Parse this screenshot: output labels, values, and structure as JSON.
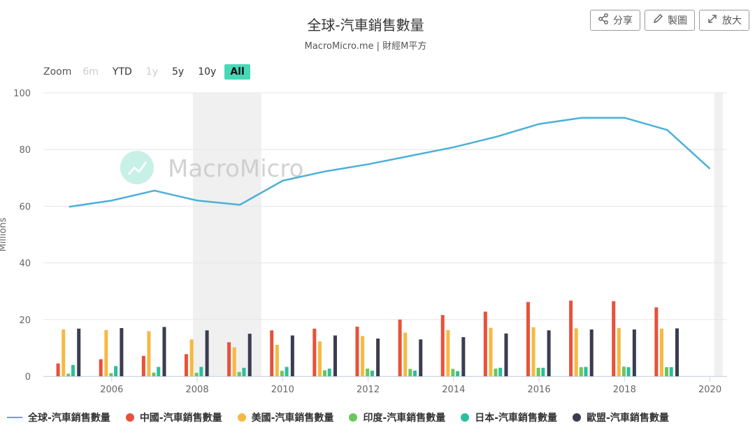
{
  "header": {
    "title": "全球-汽車銷售數量",
    "subtitle": "MacroMicro.me | 財經M平方",
    "buttons": [
      {
        "label": "分享",
        "icon": "share-icon"
      },
      {
        "label": "製圖",
        "icon": "pencil-icon"
      },
      {
        "label": "放大",
        "icon": "expand-icon"
      }
    ]
  },
  "zoom": {
    "label": "Zoom",
    "options": [
      {
        "label": "6m",
        "state": "disabled"
      },
      {
        "label": "YTD",
        "state": "normal"
      },
      {
        "label": "1y",
        "state": "disabled"
      },
      {
        "label": "5y",
        "state": "normal"
      },
      {
        "label": "10y",
        "state": "normal"
      },
      {
        "label": "All",
        "state": "active"
      }
    ]
  },
  "watermark": "MacroMicro",
  "colors": {
    "global": "#4bb0d9",
    "china": "#e8513b",
    "usa": "#f5b942",
    "india": "#6cc65c",
    "japan": "#2cbf9b",
    "europe": "#3a3d4f",
    "recession": "#f0f0f0",
    "grid": "#e6e6e6",
    "zoom_active": "#49d8b7"
  },
  "chart_data": {
    "type": "bar",
    "ylabel": "Millions",
    "ylim": [
      0,
      100
    ],
    "yticks": [
      0,
      20,
      40,
      60,
      80,
      100
    ],
    "xlim": [
      2004.4,
      2020.4
    ],
    "xticks": [
      2006,
      2008,
      2010,
      2012,
      2014,
      2016,
      2018,
      2020
    ],
    "shaded_ranges": [
      [
        2007.9,
        2009.5
      ],
      [
        2020.1,
        2020.3
      ]
    ],
    "x": [
      2005,
      2006,
      2007,
      2008,
      2009,
      2010,
      2011,
      2012,
      2013,
      2014,
      2015,
      2016,
      2017,
      2018,
      2019,
      2020
    ],
    "line_series": {
      "name": "全球-汽車銷售數量",
      "values": [
        59.8,
        62.0,
        65.5,
        62.0,
        60.5,
        69.0,
        72.3,
        74.8,
        77.8,
        80.8,
        84.5,
        89.0,
        91.2,
        91.2,
        86.9,
        73.2
      ]
    },
    "series": [
      {
        "name": "中國-汽車銷售數量",
        "values": [
          4.5,
          6.0,
          7.2,
          7.8,
          12.0,
          16.2,
          16.8,
          17.5,
          20.0,
          21.6,
          22.8,
          26.2,
          26.7,
          26.5,
          24.3,
          null
        ]
      },
      {
        "name": "美國-汽車銷售數量",
        "values": [
          16.5,
          16.3,
          15.9,
          13.0,
          10.2,
          11.1,
          12.3,
          14.2,
          15.4,
          16.3,
          17.1,
          17.3,
          16.9,
          17.0,
          16.8,
          null
        ]
      },
      {
        "name": "印度-汽車銷售數量",
        "values": [
          0.9,
          1.1,
          1.3,
          1.2,
          1.5,
          1.9,
          2.1,
          2.7,
          2.6,
          2.6,
          2.7,
          3.0,
          3.2,
          3.4,
          3.2,
          null
        ]
      },
      {
        "name": "日本-汽車銷售數量",
        "values": [
          4.0,
          3.6,
          3.3,
          3.3,
          3.0,
          3.3,
          2.7,
          2.0,
          2.0,
          1.8,
          3.0,
          3.0,
          3.3,
          3.2,
          3.2,
          null
        ]
      },
      {
        "name": "歐盟-汽車銷售數量",
        "values": [
          16.8,
          17.0,
          17.4,
          16.2,
          15.0,
          14.4,
          14.4,
          13.3,
          13.0,
          13.8,
          15.1,
          16.2,
          16.5,
          16.5,
          16.9,
          null
        ]
      }
    ]
  },
  "legend": [
    {
      "label": "全球-汽車銷售數量",
      "kind": "line",
      "color": "#4bb0d9"
    },
    {
      "label": "中國-汽車銷售數量",
      "kind": "dot",
      "color": "#e8513b"
    },
    {
      "label": "美國-汽車銷售數量",
      "kind": "dot",
      "color": "#f5b942"
    },
    {
      "label": "印度-汽車銷售數量",
      "kind": "dot",
      "color": "#6cc65c"
    },
    {
      "label": "日本-汽車銷售數量",
      "kind": "dot",
      "color": "#2cbf9b"
    },
    {
      "label": "歐盟-汽車銷售數量",
      "kind": "dot",
      "color": "#3a3d4f"
    }
  ]
}
